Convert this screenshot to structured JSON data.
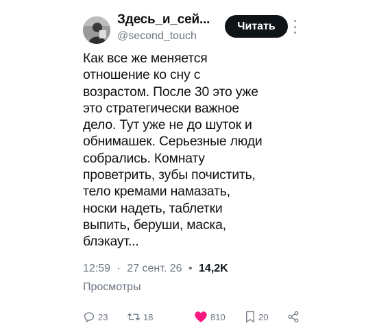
{
  "author": {
    "name": "Здесь_и_сей...",
    "handle": "@second_touch"
  },
  "follow_button": {
    "label": "Читать"
  },
  "tweet": {
    "text_lines": [
      "Как все же меняется",
      "отношение ко сну с",
      "возрастом. После 30 это уже",
      "это стратегически важное",
      "дело. Тут уже не до шуток и",
      "обнимашек. Серьезные люди",
      "собрались. Комнату",
      "проветрить, зубы почистить,",
      "тело кремами намазать,",
      "носки надеть, таблетки",
      "выпить, беруши, маска,",
      "блэкаут..."
    ]
  },
  "meta": {
    "time": "12:59",
    "separator": "·",
    "date": "27 сент. 26",
    "views_separator": "•",
    "views_count": "14,2K",
    "views_label": "Просмотры"
  },
  "actions": {
    "replies": {
      "icon": "reply-icon",
      "count": "23"
    },
    "retweets": {
      "icon": "retweet-icon",
      "count": "18"
    },
    "likes": {
      "icon": "heart-icon",
      "count": "810",
      "color": "#f91880"
    },
    "bookmarks": {
      "icon": "bookmark-icon",
      "count": "20"
    },
    "share": {
      "icon": "share-icon"
    }
  },
  "colors": {
    "text": "#0f1419",
    "secondary": "#6b7680",
    "like": "#f91880",
    "button_bg": "#0f1419"
  }
}
